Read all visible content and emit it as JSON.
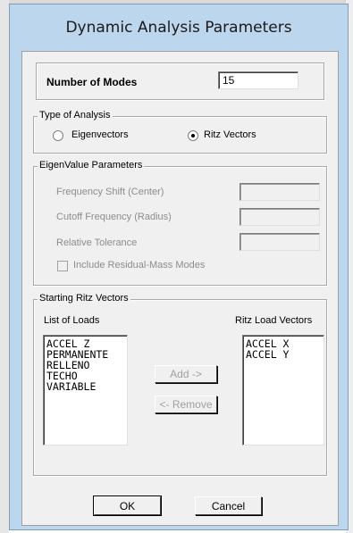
{
  "window": {
    "title": "Dynamic Analysis Parameters"
  },
  "modes": {
    "label": "Number of Modes",
    "value": "15"
  },
  "analysis_type": {
    "group_label": "Type of Analysis",
    "options": [
      {
        "label": "Eigenvectors",
        "selected": false
      },
      {
        "label": "Ritz Vectors",
        "selected": true
      }
    ]
  },
  "eigen": {
    "group_label": "EigenValue Parameters",
    "frequency_shift_label": "Frequency Shift  (Center)",
    "cutoff_label": "Cutoff Frequency  (Radius)",
    "tolerance_label": "Relative Tolerance",
    "residual_mass_label": "Include Residual-Mass Modes"
  },
  "ritz": {
    "group_label": "Starting Ritz Vectors",
    "list_label": "List of Loads",
    "ritz_label": "Ritz Load Vectors",
    "loads": [
      "ACCEL Z",
      "PERMANENTE",
      "RELLENO",
      "TECHO",
      "VARIABLE"
    ],
    "ritz_loads": [
      "ACCEL X",
      "ACCEL Y"
    ],
    "add_label": "Add ->",
    "remove_label": "<- Remove"
  },
  "buttons": {
    "ok": "OK",
    "cancel": "Cancel"
  }
}
